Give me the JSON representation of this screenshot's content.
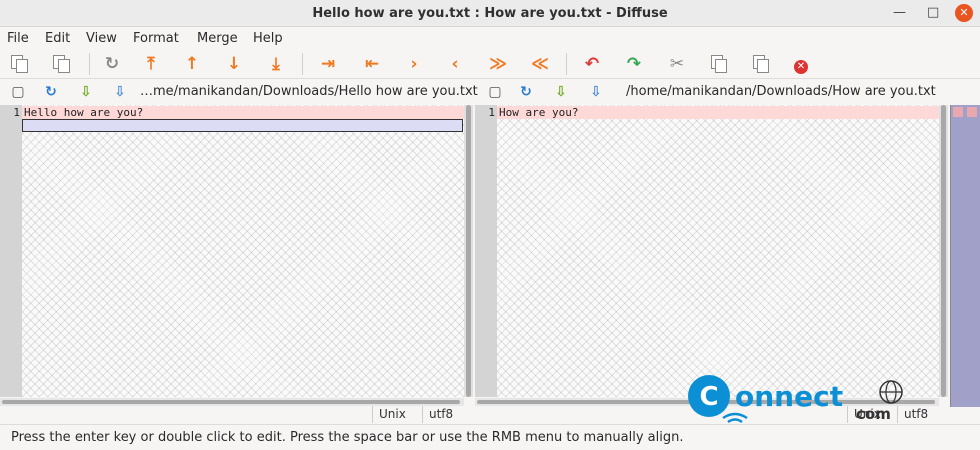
{
  "window": {
    "title": "Hello how are you.txt : How are you.txt - Diffuse",
    "minimize_glyph": "—",
    "maximize_glyph": "□",
    "close_glyph": "✕"
  },
  "menu": {
    "items": [
      "File",
      "Edit",
      "View",
      "Format",
      "Merge",
      "Help"
    ]
  },
  "toolbar": {
    "icons": {
      "realign": "↻",
      "first_change": "⤒",
      "prev_change": "↑",
      "next_change": "↓",
      "last_change": "⤓",
      "merge_from_left": "⇥",
      "merge_from_right": "⇤",
      "merge_right": "›",
      "merge_left": "‹",
      "split_right": "≫",
      "split_left": "≪",
      "undo": "↶",
      "redo": "↷",
      "cut": "✂",
      "close": "✕"
    }
  },
  "left_pane": {
    "path": "…me/manikandan/Downloads/Hello how are you.txt",
    "line_numbers": [
      "1"
    ],
    "lines": [
      "Hello how are you?"
    ],
    "eol": "Unix",
    "encoding": "utf8"
  },
  "right_pane": {
    "path": "/home/manikandan/Downloads/How are you.txt",
    "line_numbers": [
      "1"
    ],
    "lines": [
      "How are you?"
    ],
    "eol": "Unix",
    "encoding": "utf8"
  },
  "pathbar_icons": {
    "open": "▢",
    "reload": "↻",
    "save": "⇩",
    "save_as": "⇩"
  },
  "status": {
    "message": "Press the enter key or double click to edit.  Press the space bar or use the RMB menu to manually align."
  },
  "watermark": {
    "brand_left": "C",
    "brand_main": "onnect",
    "brand_sub": "com"
  },
  "colors": {
    "diff_highlight": "#ffd8d8",
    "overview_bar": "#a0a0c8",
    "toolbar_accent": "#f07a22"
  }
}
